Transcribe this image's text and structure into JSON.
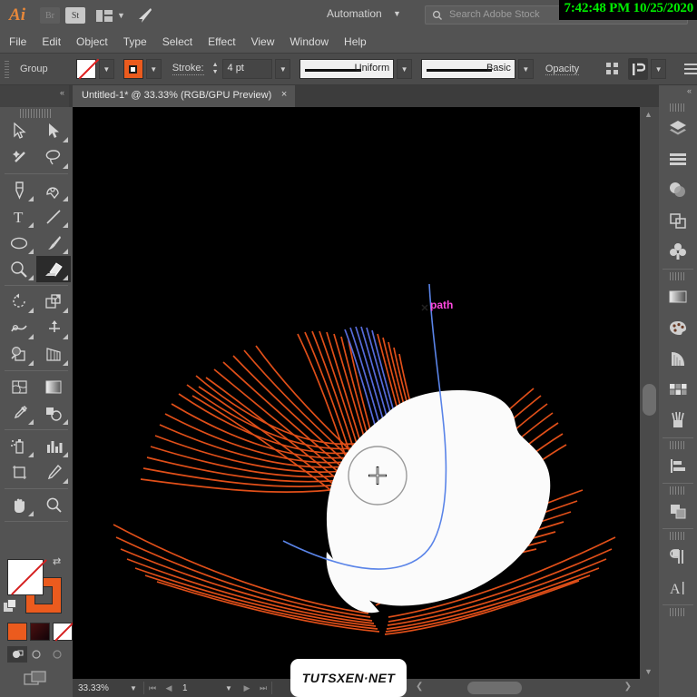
{
  "app": {
    "name": "Ai",
    "bridge_label": "Br",
    "stock_label": "St",
    "automation_label": "Automation",
    "search_placeholder": "Search Adobe Stock",
    "clock": "7:42:48 PM 10/25/2020"
  },
  "menu": {
    "items": [
      "File",
      "Edit",
      "Object",
      "Type",
      "Select",
      "Effect",
      "View",
      "Window",
      "Help"
    ]
  },
  "control_bar": {
    "selection_label": "Group",
    "fill_swatch": "none",
    "stroke_swatch_color": "#eb5b1e",
    "stroke_label": "Stroke:",
    "stroke_weight": "4 pt",
    "variable_width_profile": "Uniform",
    "brush_definition": "Basic",
    "opacity_label": "Opacity"
  },
  "document": {
    "tab_title": "Untitled-1* @ 33.33% (RGB/GPU Preview)",
    "close_label": "×"
  },
  "tools": {
    "rows": [
      [
        {
          "name": "selection-tool",
          "label": "Selection"
        },
        {
          "name": "direct-selection-tool",
          "label": "Direct Selection"
        }
      ],
      [
        {
          "name": "magic-wand-tool",
          "label": "Magic Wand"
        },
        {
          "name": "lasso-tool",
          "label": "Lasso"
        }
      ],
      [
        {
          "name": "pen-tool",
          "label": "Pen"
        },
        {
          "name": "curvature-tool",
          "label": "Curvature"
        }
      ],
      [
        {
          "name": "type-tool",
          "label": "Type"
        },
        {
          "name": "line-segment-tool",
          "label": "Line Segment"
        }
      ],
      [
        {
          "name": "ellipse-tool",
          "label": "Ellipse"
        },
        {
          "name": "paintbrush-tool",
          "label": "Paintbrush"
        }
      ],
      [
        {
          "name": "shaper-tool",
          "label": "Shaper"
        },
        {
          "name": "eraser-tool",
          "label": "Eraser"
        }
      ],
      [
        {
          "name": "rotate-tool",
          "label": "Rotate"
        },
        {
          "name": "scale-tool",
          "label": "Scale"
        }
      ],
      [
        {
          "name": "width-tool",
          "label": "Width"
        },
        {
          "name": "free-transform-tool",
          "label": "Free Transform"
        }
      ],
      [
        {
          "name": "shape-builder-tool",
          "label": "Shape Builder"
        },
        {
          "name": "perspective-grid-tool",
          "label": "Perspective Grid"
        }
      ],
      [
        {
          "name": "mesh-tool",
          "label": "Mesh"
        },
        {
          "name": "gradient-tool",
          "label": "Gradient"
        }
      ],
      [
        {
          "name": "eyedropper-tool",
          "label": "Eyedropper"
        },
        {
          "name": "blend-tool",
          "label": "Blend"
        }
      ],
      [
        {
          "name": "symbol-sprayer-tool",
          "label": "Symbol Sprayer"
        },
        {
          "name": "column-graph-tool",
          "label": "Column Graph"
        }
      ],
      [
        {
          "name": "artboard-tool",
          "label": "Artboard"
        },
        {
          "name": "slice-tool",
          "label": "Slice"
        }
      ],
      [
        {
          "name": "hand-tool",
          "label": "Hand"
        },
        {
          "name": "zoom-tool",
          "label": "Zoom"
        }
      ]
    ],
    "selected": "eraser-tool",
    "fill_state": "none",
    "stroke_color": "#eb5b1e",
    "color_modes": [
      "color",
      "gradient",
      "none"
    ],
    "draw_modes": [
      "draw-normal",
      "draw-behind",
      "draw-inside"
    ],
    "selected_draw_mode": "draw-normal"
  },
  "right_dock": {
    "collapse_label": "«",
    "panels": [
      {
        "name": "layers-panel-icon"
      },
      {
        "name": "properties-panel-icon"
      },
      {
        "name": "transparency-panel-icon"
      },
      {
        "name": "pathfinder-panel-icon"
      },
      {
        "name": "symbols-panel-icon"
      },
      {
        "name": "gradient-panel-icon"
      },
      {
        "name": "color-panel-icon"
      },
      {
        "name": "color-guide-panel-icon"
      },
      {
        "name": "swatches-panel-icon"
      },
      {
        "name": "brushes-panel-icon"
      },
      {
        "name": "align-panel-icon"
      },
      {
        "name": "transform-panel-icon"
      },
      {
        "name": "paragraph-panel-icon"
      },
      {
        "name": "character-panel-icon"
      }
    ]
  },
  "canvas": {
    "background": "#000000",
    "smart_guide_label": "path",
    "smart_guide_color": "#ff49e0",
    "path_stroke_color": "#5a84e8",
    "artwork_fill": "#ffffff",
    "fan_color_outer": "#e8521a",
    "fan_color_inner": "#5a6fe0",
    "cursor": "eraser-circle"
  },
  "status_bar": {
    "zoom_level": "33.33%",
    "page_number": "1",
    "first_label": "⏮",
    "prev_label": "◀",
    "next_label": "▶",
    "last_label": "⏭"
  },
  "watermark": {
    "text": "TUTSXEN·NET"
  }
}
